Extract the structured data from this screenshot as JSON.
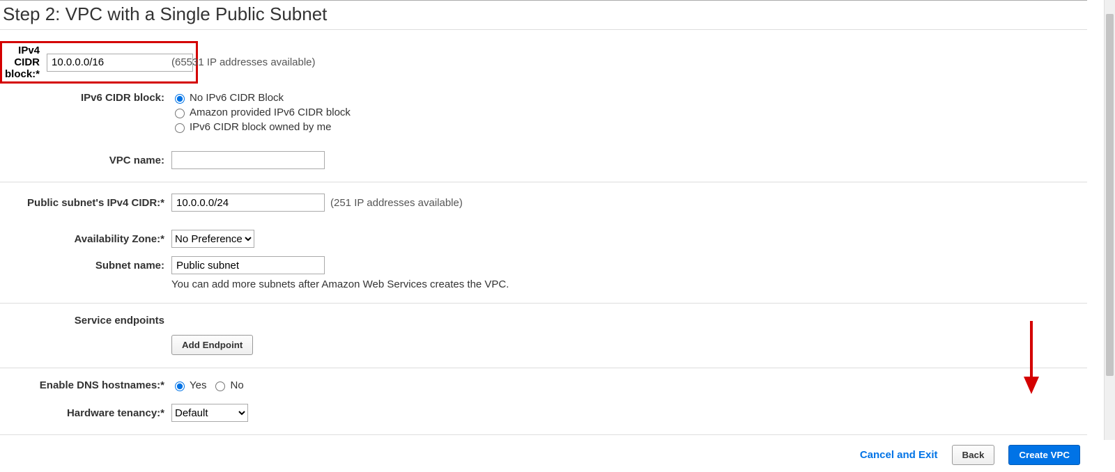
{
  "title": "Step 2: VPC with a Single Public Subnet",
  "ipv4": {
    "label": "IPv4 CIDR block:*",
    "value": "10.0.0.0/16",
    "hint": "(65531 IP addresses available)"
  },
  "ipv6": {
    "label": "IPv6 CIDR block:",
    "options": {
      "none": "No IPv6 CIDR Block",
      "amazon": "Amazon provided IPv6 CIDR block",
      "owned": "IPv6 CIDR block owned by me"
    },
    "selected": "none"
  },
  "vpc_name": {
    "label": "VPC name:",
    "value": ""
  },
  "public_subnet_cidr": {
    "label": "Public subnet's IPv4 CIDR:*",
    "value": "10.0.0.0/24",
    "hint": "(251 IP addresses available)"
  },
  "az": {
    "label": "Availability Zone:*",
    "value": "No Preference"
  },
  "subnet_name": {
    "label": "Subnet name:",
    "value": "Public subnet",
    "note": "You can add more subnets after Amazon Web Services creates the VPC."
  },
  "endpoints": {
    "label": "Service endpoints",
    "button": "Add Endpoint"
  },
  "dns": {
    "label": "Enable DNS hostnames:*",
    "yes": "Yes",
    "no": "No",
    "selected": "yes"
  },
  "tenancy": {
    "label": "Hardware tenancy:*",
    "value": "Default"
  },
  "footer": {
    "cancel": "Cancel and Exit",
    "back": "Back",
    "create": "Create VPC"
  }
}
